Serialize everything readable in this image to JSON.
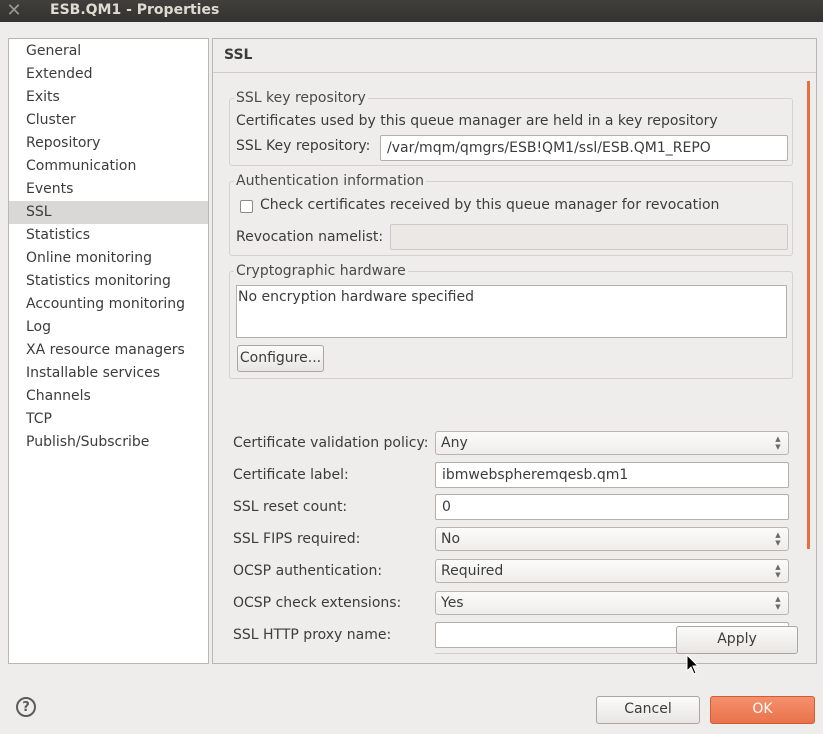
{
  "window": {
    "title": "ESB.QM1 - Properties",
    "close_glyph": "✕"
  },
  "sidebar": {
    "items": [
      {
        "label": "General"
      },
      {
        "label": "Extended"
      },
      {
        "label": "Exits"
      },
      {
        "label": "Cluster"
      },
      {
        "label": "Repository"
      },
      {
        "label": "Communication"
      },
      {
        "label": "Events"
      },
      {
        "label": "SSL",
        "selected": true
      },
      {
        "label": "Statistics"
      },
      {
        "label": "Online monitoring"
      },
      {
        "label": "Statistics monitoring"
      },
      {
        "label": "Accounting monitoring"
      },
      {
        "label": "Log"
      },
      {
        "label": "XA resource managers"
      },
      {
        "label": "Installable services"
      },
      {
        "label": "Channels"
      },
      {
        "label": "TCP"
      },
      {
        "label": "Publish/Subscribe"
      }
    ]
  },
  "panel": {
    "title": "SSL",
    "key_repository": {
      "group_title": "SSL key repository",
      "description": "Certificates used by this queue manager are held in a key repository",
      "field_label": "SSL Key repository:",
      "field_value": "/var/mqm/qmgrs/ESB!QM1/ssl/ESB.QM1_REPO"
    },
    "authentication": {
      "group_title": "Authentication information",
      "checkbox_label": "Check certificates received by this queue manager for revocation",
      "checkbox_checked": false,
      "namelist_label": "Revocation namelist:",
      "namelist_value": ""
    },
    "crypto": {
      "group_title": "Cryptographic hardware",
      "text": "No encryption hardware specified",
      "configure_button": "Configure..."
    },
    "settings": {
      "cert_validation_label": "Certificate validation policy:",
      "cert_validation_value": "Any",
      "cert_label_label": "Certificate label:",
      "cert_label_value": "ibmwebspheremqesb.qm1",
      "reset_count_label": "SSL reset count:",
      "reset_count_value": "0",
      "fips_label": "SSL FIPS required:",
      "fips_value": "No",
      "ocsp_auth_label": "OCSP authentication:",
      "ocsp_auth_value": "Required",
      "ocsp_ext_label": "OCSP check extensions:",
      "ocsp_ext_value": "Yes",
      "proxy_label": "SSL HTTP proxy name:",
      "proxy_value": ""
    },
    "apply_button": "Apply"
  },
  "footer": {
    "help_glyph": "?",
    "cancel_button": "Cancel",
    "ok_button": "OK"
  },
  "colors": {
    "accent": "#e9734b",
    "selection": "#d9d8d6",
    "titlebar": "#3a3936"
  },
  "icons": {
    "combo_arrows": "▲▼",
    "spinner_arrows": "▲▼"
  }
}
